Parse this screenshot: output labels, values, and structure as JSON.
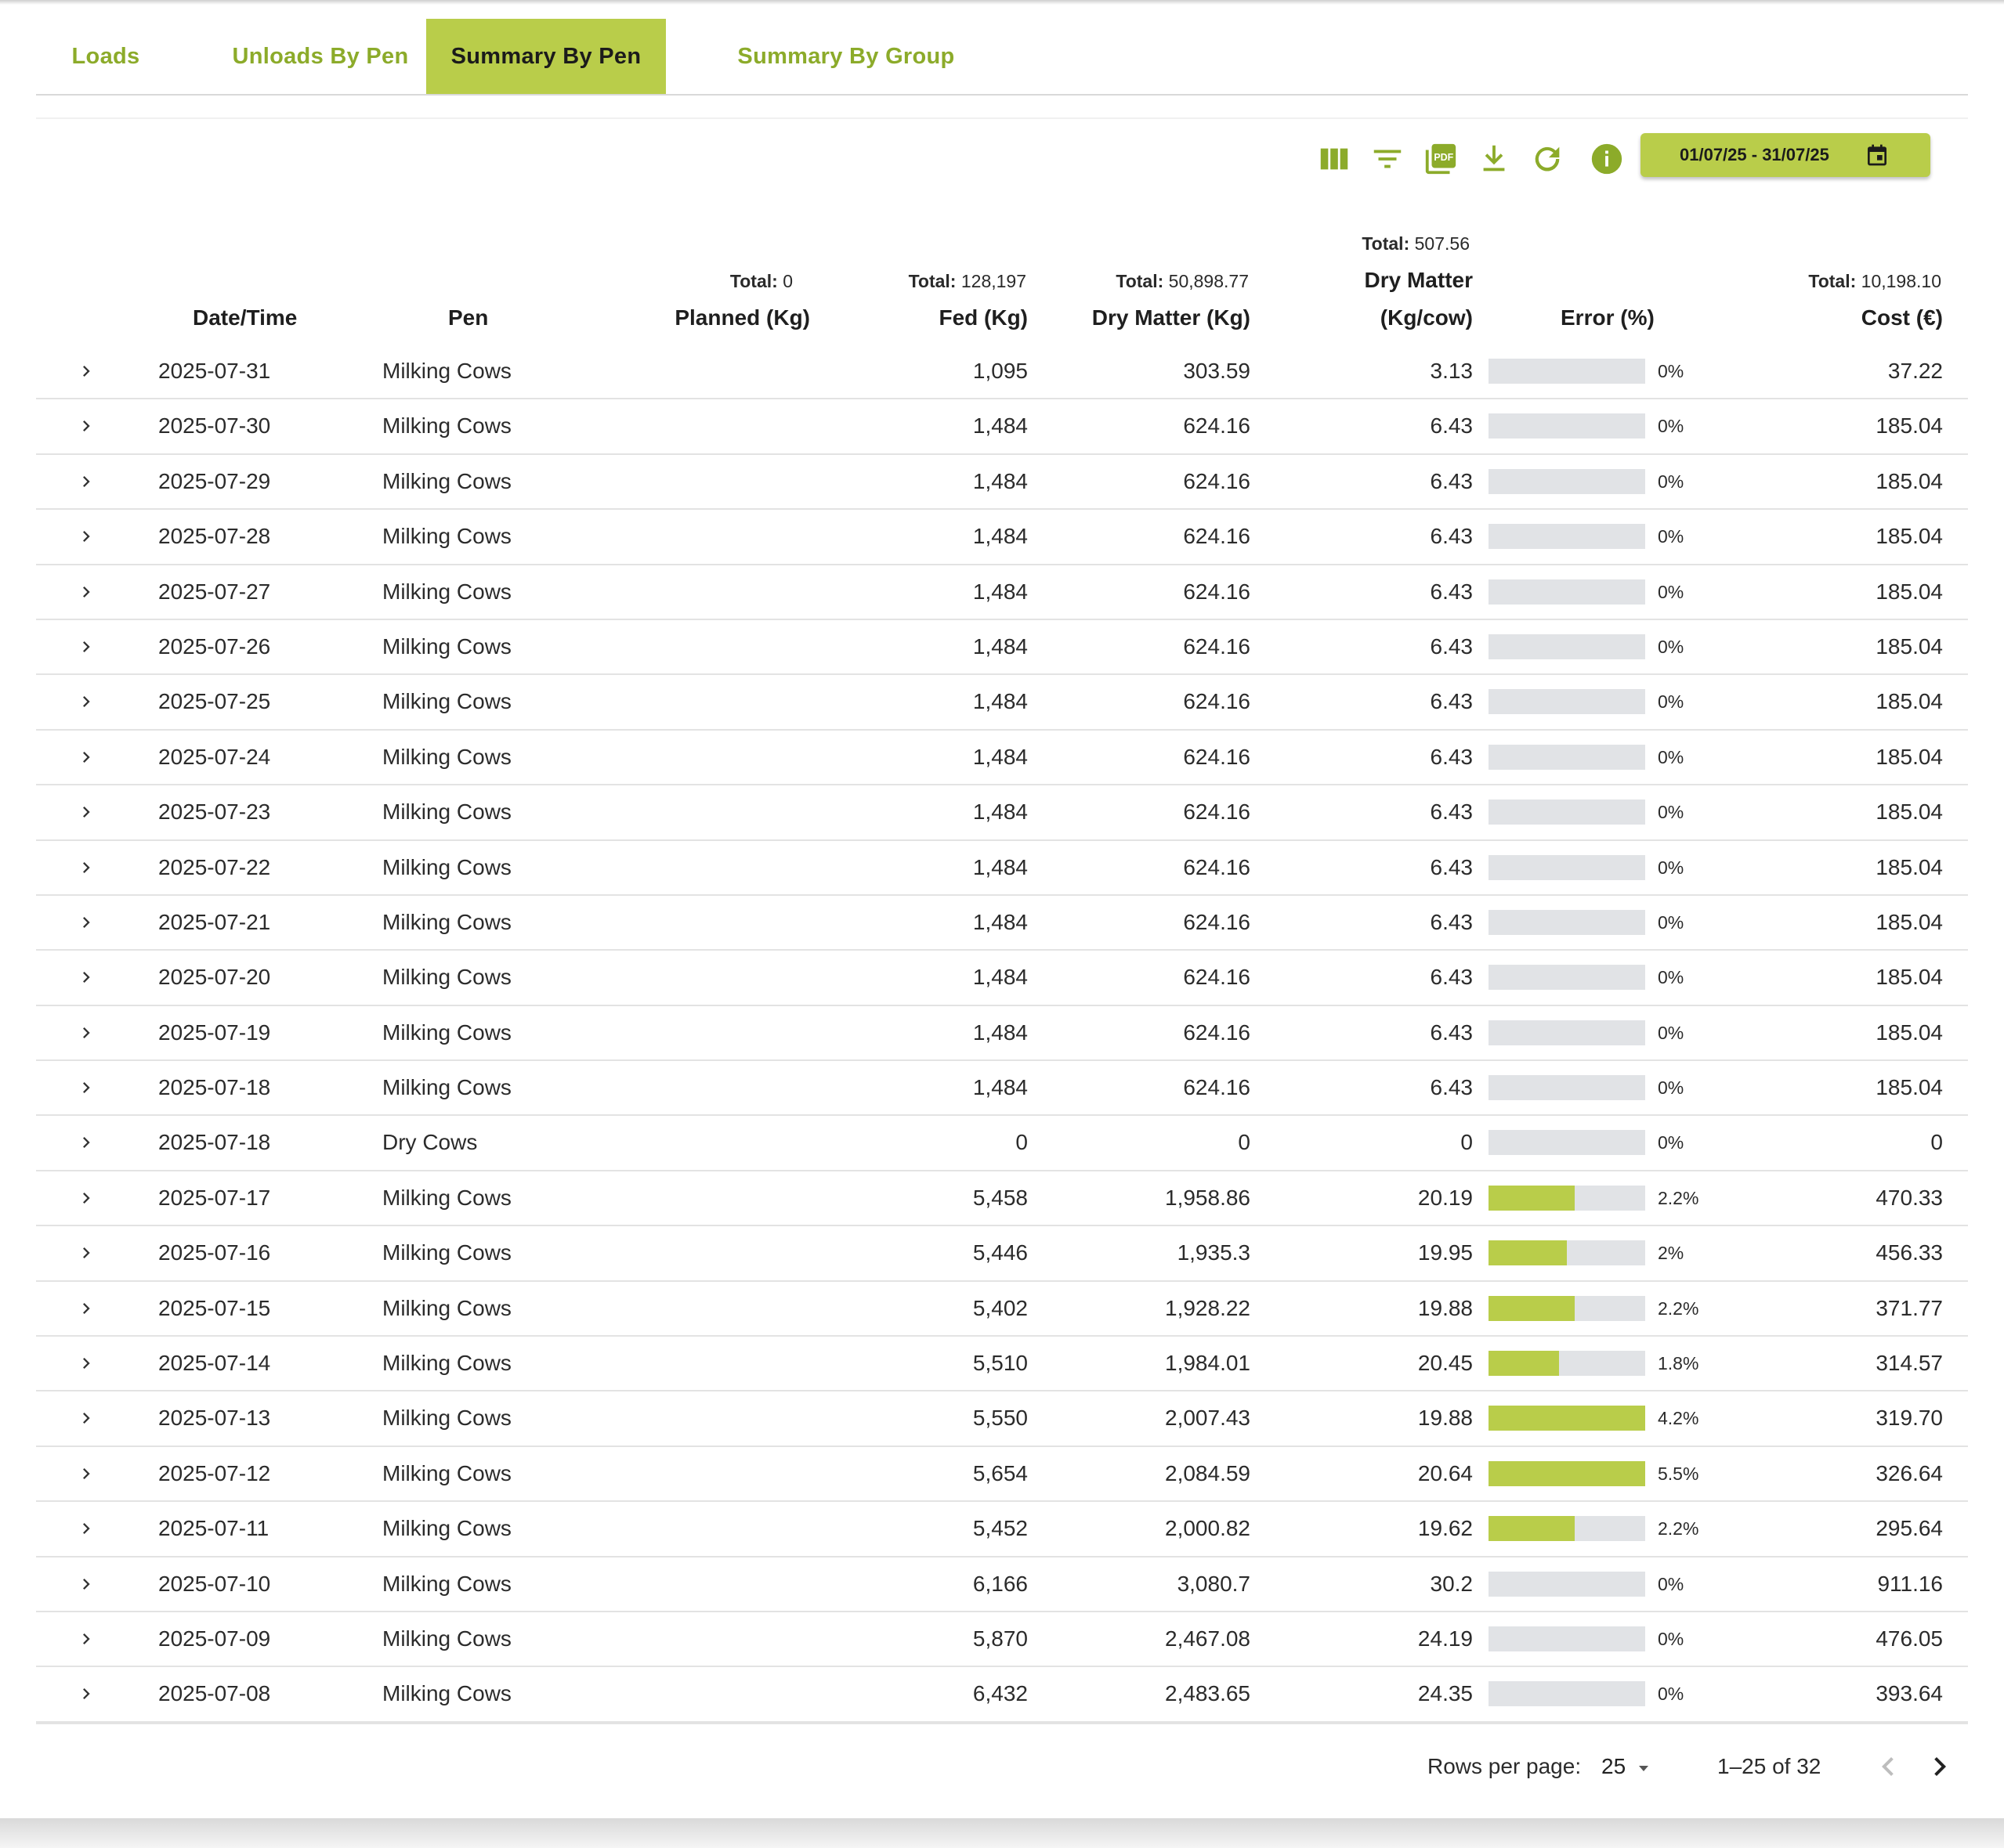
{
  "tabs": [
    {
      "label": "Loads"
    },
    {
      "label": "Unloads By Pen"
    },
    {
      "label": "Summary By Pen"
    },
    {
      "label": "Summary By Group"
    }
  ],
  "active_tab": "Summary By Pen",
  "toolbar": {
    "icons": [
      "columns-icon",
      "filter-icon",
      "pdf-icon",
      "download-icon",
      "refresh-icon",
      "info-icon"
    ],
    "pdf_badge": "PDF",
    "date_range": "01/07/25 - 31/07/25"
  },
  "colors": {
    "accent": "#b9cd4a",
    "accent_text": "#8cab2a",
    "bar_track": "#e1e3e6"
  },
  "columns": {
    "date": "Date/Time",
    "pen": "Pen",
    "planned": "Planned (Kg)",
    "fed": "Fed (Kg)",
    "dm": "Dry Matter (Kg)",
    "dmc_line1": "Dry Matter",
    "dmc_line2": "(Kg/cow)",
    "error": "Error (%)",
    "cost": "Cost (€)"
  },
  "totals": {
    "label": "Total:",
    "planned": "0",
    "fed": "128,197",
    "dm": "50,898.77",
    "dmc": "507.56",
    "cost": "10,198.10"
  },
  "rows": [
    {
      "date": "2025-07-31",
      "pen": "Milking Cows",
      "fed": "1,095",
      "dm": "303.59",
      "dmc": "3.13",
      "error": "0%",
      "error_pct": 0,
      "cost": "37.22"
    },
    {
      "date": "2025-07-30",
      "pen": "Milking Cows",
      "fed": "1,484",
      "dm": "624.16",
      "dmc": "6.43",
      "error": "0%",
      "error_pct": 0,
      "cost": "185.04"
    },
    {
      "date": "2025-07-29",
      "pen": "Milking Cows",
      "fed": "1,484",
      "dm": "624.16",
      "dmc": "6.43",
      "error": "0%",
      "error_pct": 0,
      "cost": "185.04"
    },
    {
      "date": "2025-07-28",
      "pen": "Milking Cows",
      "fed": "1,484",
      "dm": "624.16",
      "dmc": "6.43",
      "error": "0%",
      "error_pct": 0,
      "cost": "185.04"
    },
    {
      "date": "2025-07-27",
      "pen": "Milking Cows",
      "fed": "1,484",
      "dm": "624.16",
      "dmc": "6.43",
      "error": "0%",
      "error_pct": 0,
      "cost": "185.04"
    },
    {
      "date": "2025-07-26",
      "pen": "Milking Cows",
      "fed": "1,484",
      "dm": "624.16",
      "dmc": "6.43",
      "error": "0%",
      "error_pct": 0,
      "cost": "185.04"
    },
    {
      "date": "2025-07-25",
      "pen": "Milking Cows",
      "fed": "1,484",
      "dm": "624.16",
      "dmc": "6.43",
      "error": "0%",
      "error_pct": 0,
      "cost": "185.04"
    },
    {
      "date": "2025-07-24",
      "pen": "Milking Cows",
      "fed": "1,484",
      "dm": "624.16",
      "dmc": "6.43",
      "error": "0%",
      "error_pct": 0,
      "cost": "185.04"
    },
    {
      "date": "2025-07-23",
      "pen": "Milking Cows",
      "fed": "1,484",
      "dm": "624.16",
      "dmc": "6.43",
      "error": "0%",
      "error_pct": 0,
      "cost": "185.04"
    },
    {
      "date": "2025-07-22",
      "pen": "Milking Cows",
      "fed": "1,484",
      "dm": "624.16",
      "dmc": "6.43",
      "error": "0%",
      "error_pct": 0,
      "cost": "185.04"
    },
    {
      "date": "2025-07-21",
      "pen": "Milking Cows",
      "fed": "1,484",
      "dm": "624.16",
      "dmc": "6.43",
      "error": "0%",
      "error_pct": 0,
      "cost": "185.04"
    },
    {
      "date": "2025-07-20",
      "pen": "Milking Cows",
      "fed": "1,484",
      "dm": "624.16",
      "dmc": "6.43",
      "error": "0%",
      "error_pct": 0,
      "cost": "185.04"
    },
    {
      "date": "2025-07-19",
      "pen": "Milking Cows",
      "fed": "1,484",
      "dm": "624.16",
      "dmc": "6.43",
      "error": "0%",
      "error_pct": 0,
      "cost": "185.04"
    },
    {
      "date": "2025-07-18",
      "pen": "Milking Cows",
      "fed": "1,484",
      "dm": "624.16",
      "dmc": "6.43",
      "error": "0%",
      "error_pct": 0,
      "cost": "185.04"
    },
    {
      "date": "2025-07-18",
      "pen": "Dry Cows",
      "fed": "0",
      "dm": "0",
      "dmc": "0",
      "error": "0%",
      "error_pct": 0,
      "cost": "0"
    },
    {
      "date": "2025-07-17",
      "pen": "Milking Cows",
      "fed": "5,458",
      "dm": "1,958.86",
      "dmc": "20.19",
      "error": "2.2%",
      "error_pct": 2.2,
      "cost": "470.33"
    },
    {
      "date": "2025-07-16",
      "pen": "Milking Cows",
      "fed": "5,446",
      "dm": "1,935.3",
      "dmc": "19.95",
      "error": "2%",
      "error_pct": 2,
      "cost": "456.33"
    },
    {
      "date": "2025-07-15",
      "pen": "Milking Cows",
      "fed": "5,402",
      "dm": "1,928.22",
      "dmc": "19.88",
      "error": "2.2%",
      "error_pct": 2.2,
      "cost": "371.77"
    },
    {
      "date": "2025-07-14",
      "pen": "Milking Cows",
      "fed": "5,510",
      "dm": "1,984.01",
      "dmc": "20.45",
      "error": "1.8%",
      "error_pct": 1.8,
      "cost": "314.57"
    },
    {
      "date": "2025-07-13",
      "pen": "Milking Cows",
      "fed": "5,550",
      "dm": "2,007.43",
      "dmc": "19.88",
      "error": "4.2%",
      "error_pct": 4.2,
      "cost": "319.70"
    },
    {
      "date": "2025-07-12",
      "pen": "Milking Cows",
      "fed": "5,654",
      "dm": "2,084.59",
      "dmc": "20.64",
      "error": "5.5%",
      "error_pct": 5.5,
      "cost": "326.64"
    },
    {
      "date": "2025-07-11",
      "pen": "Milking Cows",
      "fed": "5,452",
      "dm": "2,000.82",
      "dmc": "19.62",
      "error": "2.2%",
      "error_pct": 2.2,
      "cost": "295.64"
    },
    {
      "date": "2025-07-10",
      "pen": "Milking Cows",
      "fed": "6,166",
      "dm": "3,080.7",
      "dmc": "30.2",
      "error": "0%",
      "error_pct": 0,
      "cost": "911.16"
    },
    {
      "date": "2025-07-09",
      "pen": "Milking Cows",
      "fed": "5,870",
      "dm": "2,467.08",
      "dmc": "24.19",
      "error": "0%",
      "error_pct": 0,
      "cost": "476.05"
    },
    {
      "date": "2025-07-08",
      "pen": "Milking Cows",
      "fed": "6,432",
      "dm": "2,483.65",
      "dmc": "24.35",
      "error": "0%",
      "error_pct": 0,
      "cost": "393.64"
    }
  ],
  "pagination": {
    "rows_per_page_label": "Rows per page:",
    "rows_per_page": "25",
    "range": "1–25 of 32"
  }
}
